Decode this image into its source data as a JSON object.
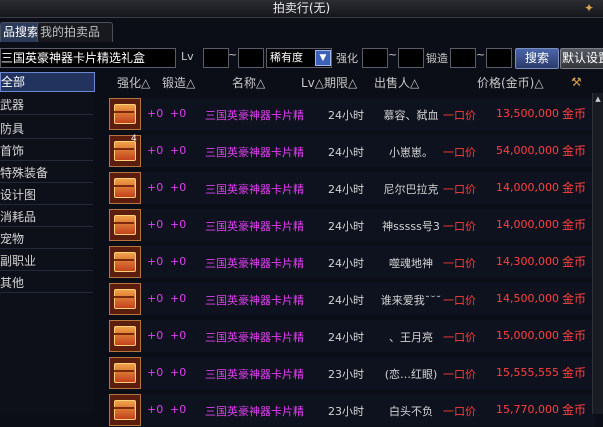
{
  "window": {
    "title": "拍卖行(无)",
    "title_icon": "sword-icon"
  },
  "tabs": [
    {
      "label": "品搜索"
    },
    {
      "label": "我的拍卖品"
    }
  ],
  "search": {
    "query": "三国英豪神器卡片精选礼盒",
    "lv_label": "Lv",
    "lv_sep": "~",
    "rarity_label": "稀有度",
    "enhance_label": "强化",
    "enhance_sep": "~",
    "forge_label": "锻造",
    "forge_sep": "~",
    "search_button": "搜索",
    "reset_button": "默认设置"
  },
  "sidebar": {
    "items": [
      {
        "label": "全部",
        "active": true
      },
      {
        "label": "武器"
      },
      {
        "label": "防具"
      },
      {
        "label": "首饰"
      },
      {
        "label": "特殊装备"
      },
      {
        "label": "设计图"
      },
      {
        "label": "消耗品"
      },
      {
        "label": "宠物"
      },
      {
        "label": "副职业"
      },
      {
        "label": "其他"
      }
    ]
  },
  "columns": {
    "enhance": "强化△",
    "forge": "锻造△",
    "name": "名称△",
    "lv_period": "Lv△期限△",
    "seller": "出售人△",
    "price": "价格(金币)△"
  },
  "listings": [
    {
      "slot_count": "",
      "enhance": "+0",
      "forge": "+0",
      "name": "三国英豪神器卡片精",
      "period": "24小时",
      "seller": "慕容、弑血",
      "buyout": "一口价",
      "price": "13,500,000",
      "currency": "金币"
    },
    {
      "slot_count": "4",
      "enhance": "+0",
      "forge": "+0",
      "name": "三国英豪神器卡片精",
      "period": "24小时",
      "seller": "小崽崽。",
      "buyout": "一口价",
      "price": "54,000,000",
      "currency": "金币"
    },
    {
      "slot_count": "",
      "enhance": "+0",
      "forge": "+0",
      "name": "三国英豪神器卡片精",
      "period": "24小时",
      "seller": "尼尔巴拉克",
      "buyout": "一口价",
      "price": "14,000,000",
      "currency": "金币"
    },
    {
      "slot_count": "",
      "enhance": "+0",
      "forge": "+0",
      "name": "三国英豪神器卡片精",
      "period": "24小时",
      "seller": "神sssss号3",
      "buyout": "一口价",
      "price": "14,000,000",
      "currency": "金币"
    },
    {
      "slot_count": "",
      "enhance": "+0",
      "forge": "+0",
      "name": "三国英豪神器卡片精",
      "period": "24小时",
      "seller": "噬魂地神",
      "buyout": "一口价",
      "price": "14,300,000",
      "currency": "金币"
    },
    {
      "slot_count": "",
      "enhance": "+0",
      "forge": "+0",
      "name": "三国英豪神器卡片精",
      "period": "24小时",
      "seller": "谁来爱我˘˘˘",
      "buyout": "一口价",
      "price": "14,500,000",
      "currency": "金币"
    },
    {
      "slot_count": "",
      "enhance": "+0",
      "forge": "+0",
      "name": "三国英豪神器卡片精",
      "period": "24小时",
      "seller": "、王月亮",
      "buyout": "一口价",
      "price": "15,000,000",
      "currency": "金币"
    },
    {
      "slot_count": "",
      "enhance": "+0",
      "forge": "+0",
      "name": "三国英豪神器卡片精",
      "period": "23小时",
      "seller": "(恋…红眼)",
      "buyout": "一口价",
      "price": "15,555,555",
      "currency": "金币"
    },
    {
      "slot_count": "",
      "enhance": "+0",
      "forge": "+0",
      "name": "三国英豪神器卡片精",
      "period": "23小时",
      "seller": "白头不负",
      "buyout": "一口价",
      "price": "15,770,000",
      "currency": "金币"
    }
  ],
  "colors": {
    "item_name": "#e040f0",
    "price": "#ff4040",
    "accent": "#3c62b8"
  }
}
